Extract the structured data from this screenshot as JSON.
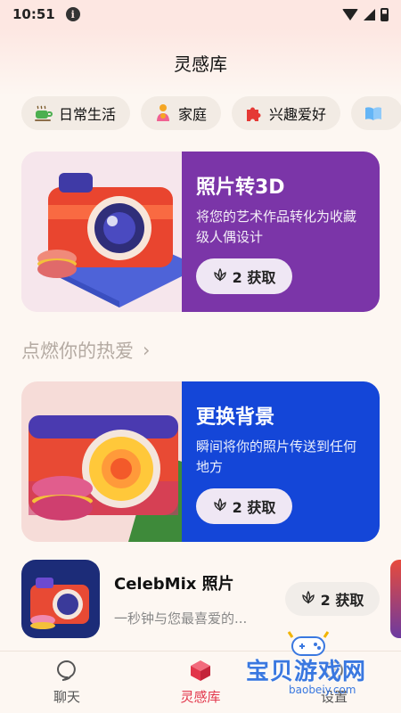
{
  "status": {
    "time": "10:51",
    "info": "i"
  },
  "header": {
    "title": "灵感库"
  },
  "chips": [
    {
      "icon": "tea-cup-icon",
      "label": "日常生活"
    },
    {
      "icon": "family-icon",
      "label": "家庭"
    },
    {
      "icon": "puzzle-icon",
      "label": "兴趣爱好"
    },
    {
      "icon": "book-icon",
      "label": ""
    }
  ],
  "card1": {
    "title": "照片转3D",
    "desc": "将您的艺术作品转化为收藏级人偶设计",
    "button": "2 获取",
    "color": "#7b35a8"
  },
  "section": {
    "title": "点燃你的热爱",
    "arrow": "›"
  },
  "card2": {
    "title": "更换背景",
    "desc": "瞬间将你的照片传送到任何地方",
    "button": "2 获取",
    "color": "#1446d8"
  },
  "list_item": {
    "name": "CelebMix 照片",
    "sub": "一秒钟与您最喜爱的...",
    "button": "2 获取"
  },
  "tabs": [
    {
      "icon": "chat-bubble-icon",
      "label": "聊天"
    },
    {
      "icon": "cube-icon",
      "label": "灵感库",
      "active": true
    },
    {
      "icon": "settings-icon",
      "label": "设置"
    }
  ],
  "watermark": {
    "text": "宝贝游戏网",
    "url": "baobeiy.com"
  }
}
